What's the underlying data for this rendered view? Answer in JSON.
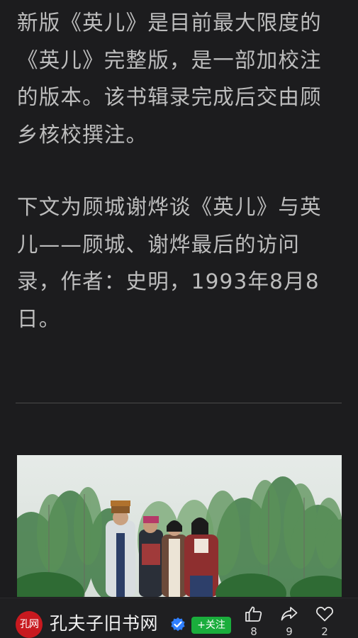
{
  "article": {
    "paragraph_1": "新版《英儿》是目前最大限度的《英儿》完整版，是一部加校注的版本。该书辑录完成后交由顾乡核校撰注。",
    "paragraph_2": "下文为顾城谢烨谈《英儿》与英儿——顾城、谢烨最后的访问录，作者：史明，1993年8月8日。"
  },
  "author_bar": {
    "avatar_text": "孔网",
    "name": "孔夫子旧书网",
    "follow_label": "+关注",
    "verified_icon": "verified-badge-icon",
    "accent_color": "#1aad3c",
    "verified_color": "#2f7fff",
    "avatar_color": "#c8191f"
  },
  "actions": {
    "like_count": "8",
    "share_count": "9",
    "favorite_count": "2",
    "like_icon": "thumbs-up-icon",
    "share_icon": "share-icon",
    "favorite_icon": "heart-icon"
  }
}
